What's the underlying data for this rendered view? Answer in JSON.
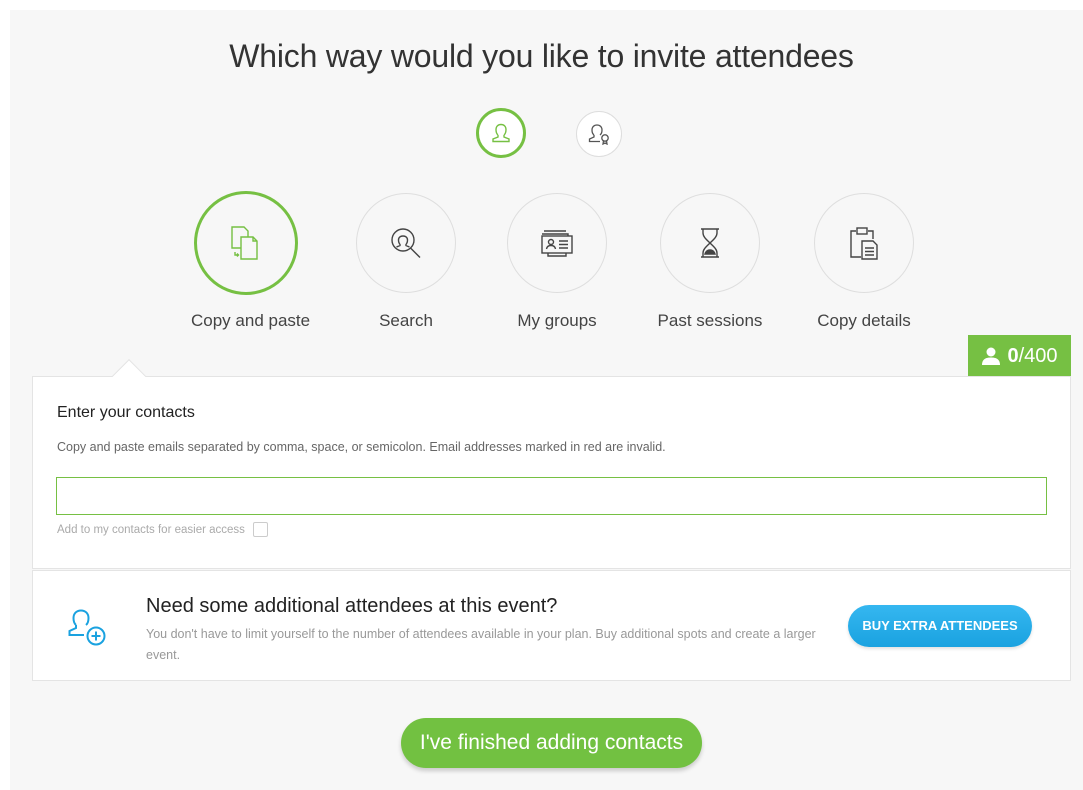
{
  "page_title": "Which way would you like to invite attendees",
  "mode_toggle": [
    {
      "icon": "single-attendee-icon",
      "active": true
    },
    {
      "icon": "attendee-with-badge-icon",
      "active": false
    }
  ],
  "methods": [
    {
      "label": "Copy and paste",
      "icon": "copy-paste-icon",
      "active": true
    },
    {
      "label": "Search",
      "icon": "search-person-icon",
      "active": false
    },
    {
      "label": "My groups",
      "icon": "groups-icon",
      "active": false
    },
    {
      "label": "Past sessions",
      "icon": "hourglass-icon",
      "active": false
    },
    {
      "label": "Copy details",
      "icon": "clipboard-icon",
      "active": false
    }
  ],
  "counter": {
    "current": "0",
    "max": "/400",
    "icon": "person-icon"
  },
  "contacts": {
    "title": "Enter your contacts",
    "help": "Copy and paste emails separated by comma, space, or semicolon. Email addresses marked in red are invalid.",
    "input_value": "",
    "input_placeholder": "",
    "add_to_contacts_label": "Add to my contacts for easier access",
    "add_to_contacts_checked": false
  },
  "extra": {
    "title": "Need some additional attendees at this event?",
    "text": "You don't have to limit yourself to the number of attendees available in your plan. Buy additional spots and create a larger event.",
    "button": "BUY EXTRA ATTENDEES",
    "icon": "add-attendee-icon"
  },
  "finish_button": "I've finished adding contacts",
  "colors": {
    "accent": "#76c043",
    "button_blue": "#1aa2e0",
    "panel_bg": "#f7f7f7"
  }
}
